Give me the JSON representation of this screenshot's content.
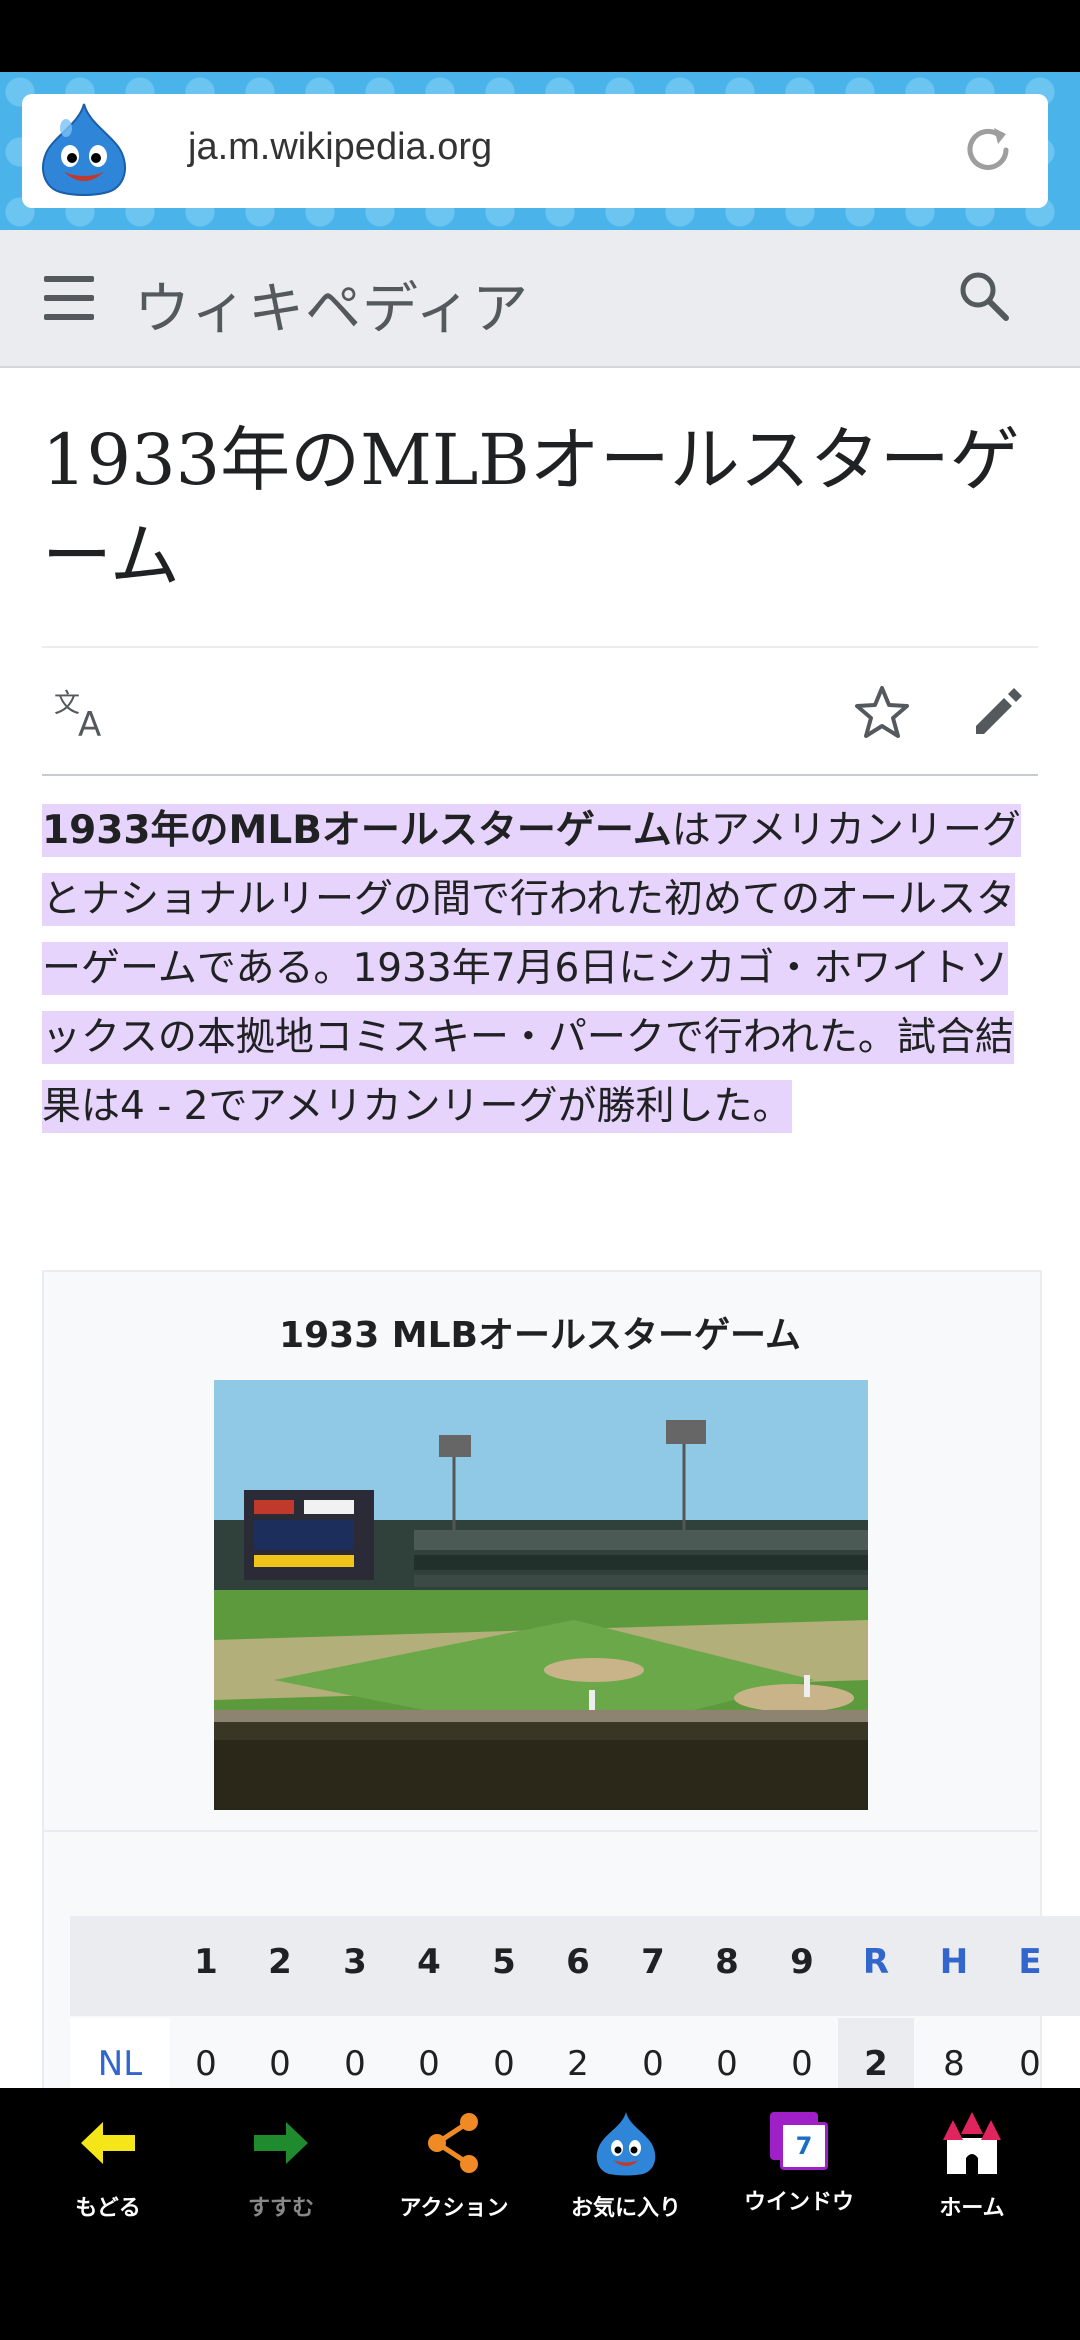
{
  "browser": {
    "url": "ja.m.wikipedia.org"
  },
  "header": {
    "site_name": "ウィキペディア"
  },
  "article": {
    "title": "1933年のMLBオールスターゲーム",
    "intro_bold": "1933年のMLBオールスターゲーム",
    "intro_rest": "はアメリカンリーグとナショナルリーグの間で行われた初めてのオールスターゲームである。1933年7月6日にシカゴ・ホワイトソックスの本拠地コミスキー・パークで行われた。試合結果は4 - 2でアメリカンリーグが勝利した。"
  },
  "infobox": {
    "title": "1933 MLBオールスターゲーム",
    "score_headers": [
      "1",
      "2",
      "3",
      "4",
      "5",
      "6",
      "7",
      "8",
      "9",
      "R",
      "H",
      "E"
    ],
    "rows": [
      {
        "team": "NL",
        "innings": [
          "0",
          "0",
          "0",
          "0",
          "0",
          "2",
          "0",
          "0",
          "0"
        ],
        "R": "2",
        "H": "8",
        "E": "0"
      }
    ]
  },
  "bottom_nav": {
    "items": [
      {
        "label": "もどる",
        "icon": "back-arrow-icon"
      },
      {
        "label": "すすむ",
        "icon": "forward-arrow-icon"
      },
      {
        "label": "アクション",
        "icon": "share-icon"
      },
      {
        "label": "お気に入り",
        "icon": "slime-favorite-icon"
      },
      {
        "label": "ウインドウ",
        "icon": "window-icon",
        "badge": "7"
      },
      {
        "label": "ホーム",
        "icon": "castle-home-icon"
      }
    ]
  },
  "colors": {
    "highlight": "#e7d4fc",
    "link": "#3366cc",
    "header_bg": "#eaecf0",
    "urlbar_bg": "#4ab4ea"
  }
}
